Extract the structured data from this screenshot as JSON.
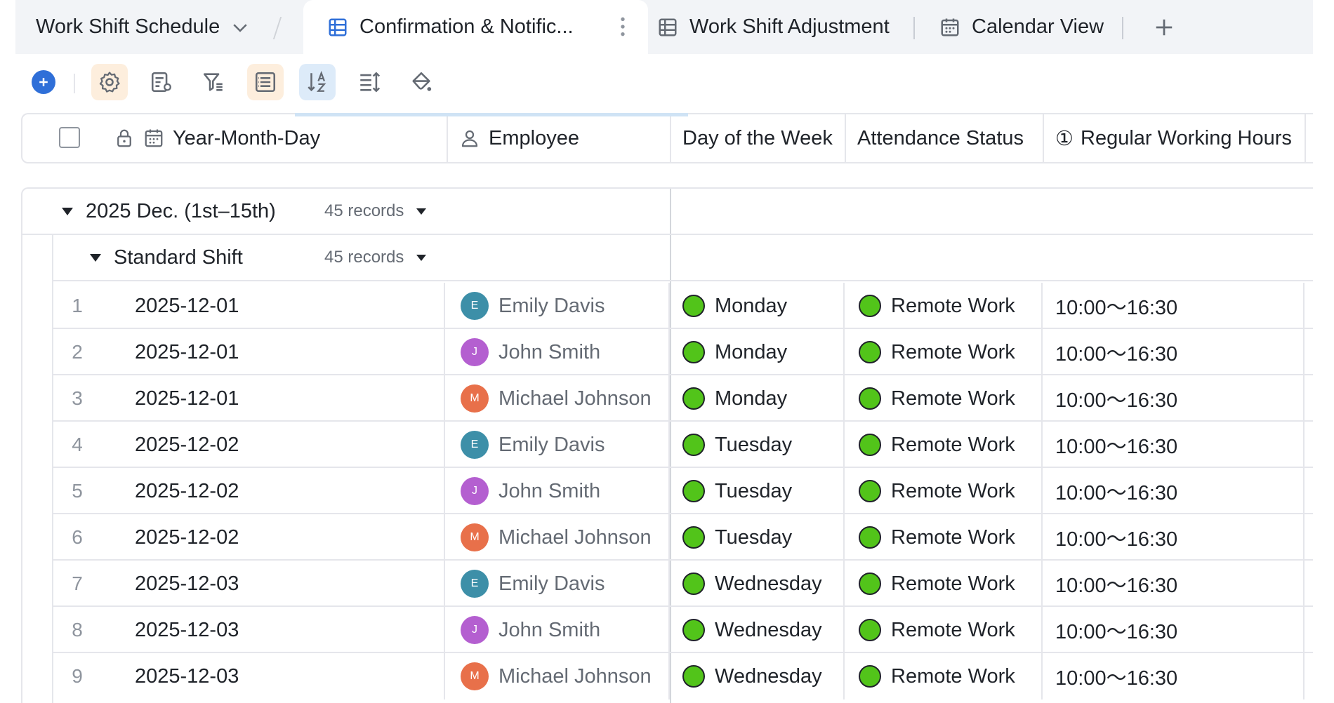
{
  "tabs": [
    {
      "label": "Work Shift Schedule",
      "icon": "chevron-down-icon"
    },
    {
      "label": "Confirmation & Notific...",
      "icon": "grid-table-icon",
      "active": true
    },
    {
      "label": "Work Shift Adjustment",
      "icon": "grid-table-icon"
    },
    {
      "label": "Calendar View",
      "icon": "calendar-icon"
    }
  ],
  "add_tab_label": "+",
  "toolbar": {
    "add_icon": "plus-circle-icon",
    "buttons": [
      "settings-icon",
      "field-settings-icon",
      "filter-icon",
      "group-icon",
      "sort-icon",
      "row-height-icon",
      "paint-bucket-icon"
    ]
  },
  "columns": {
    "date": "Year-Month-Day",
    "employee": "Employee",
    "day_of_week": "Day of the Week",
    "attendance": "Attendance Status",
    "hours": "Regular Working Hours",
    "hours_prefix": "①"
  },
  "groups": [
    {
      "title": "2025 Dec. (1st–15th)",
      "count": "45 records"
    },
    {
      "title": "Standard Shift",
      "count": "45 records"
    }
  ],
  "rows": [
    {
      "num": "1",
      "date": "2025-12-01",
      "initial": "E",
      "employee": "Emily Davis",
      "dow": "Monday",
      "attendance": "Remote Work",
      "hours": "10:00〜16:30"
    },
    {
      "num": "2",
      "date": "2025-12-01",
      "initial": "J",
      "employee": "John Smith",
      "dow": "Monday",
      "attendance": "Remote Work",
      "hours": "10:00〜16:30"
    },
    {
      "num": "3",
      "date": "2025-12-01",
      "initial": "M",
      "employee": "Michael Johnson",
      "dow": "Monday",
      "attendance": "Remote Work",
      "hours": "10:00〜16:30"
    },
    {
      "num": "4",
      "date": "2025-12-02",
      "initial": "E",
      "employee": "Emily Davis",
      "dow": "Tuesday",
      "attendance": "Remote Work",
      "hours": "10:00〜16:30"
    },
    {
      "num": "5",
      "date": "2025-12-02",
      "initial": "J",
      "employee": "John Smith",
      "dow": "Tuesday",
      "attendance": "Remote Work",
      "hours": "10:00〜16:30"
    },
    {
      "num": "6",
      "date": "2025-12-02",
      "initial": "M",
      "employee": "Michael Johnson",
      "dow": "Tuesday",
      "attendance": "Remote Work",
      "hours": "10:00〜16:30"
    },
    {
      "num": "7",
      "date": "2025-12-03",
      "initial": "E",
      "employee": "Emily Davis",
      "dow": "Wednesday",
      "attendance": "Remote Work",
      "hours": "10:00〜16:30"
    },
    {
      "num": "8",
      "date": "2025-12-03",
      "initial": "J",
      "employee": "John Smith",
      "dow": "Wednesday",
      "attendance": "Remote Work",
      "hours": "10:00〜16:30"
    },
    {
      "num": "9",
      "date": "2025-12-03",
      "initial": "M",
      "employee": "Michael Johnson",
      "dow": "Wednesday",
      "attendance": "Remote Work",
      "hours": "10:00〜16:30"
    }
  ],
  "colors": {
    "status_green": "#52c41a",
    "accent_blue": "#2f6fd8",
    "avatar_emily": "#3d8fa8",
    "avatar_john": "#b45fd0",
    "avatar_michael": "#e8704a"
  }
}
